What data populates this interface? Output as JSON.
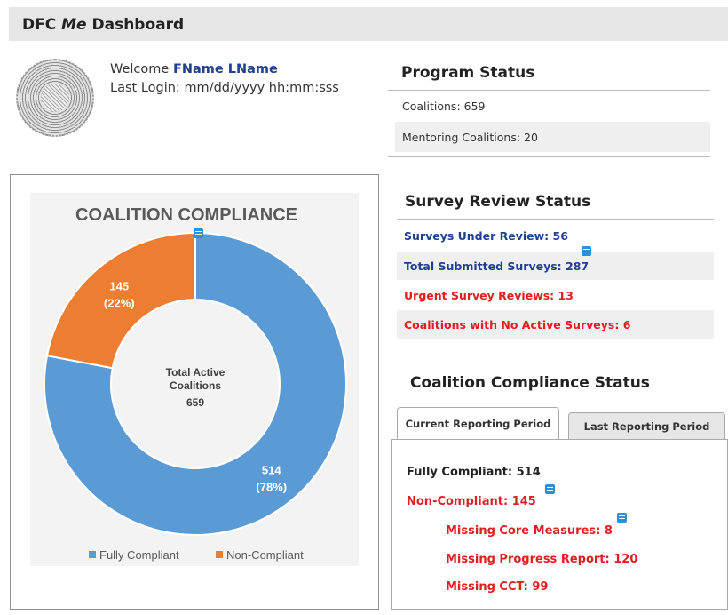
{
  "header": {
    "title_pre": "DFC ",
    "title_em": "Me",
    "title_post": " Dashboard"
  },
  "user": {
    "welcome_label": "Welcome",
    "name": "FName LName",
    "last_login_label": "Last Login:",
    "last_login_value": "mm/dd/yyyy  hh:mm:sss"
  },
  "program_status": {
    "heading": "Program Status",
    "rows": [
      "Coalitions: 659",
      "Mentoring Coalitions: 20"
    ]
  },
  "survey_review": {
    "heading": "Survey Review Status",
    "rows": [
      "Surveys Under Review: 56",
      "Total Submitted Surveys: 287",
      "Urgent Survey Reviews: 13",
      "Coalitions with No Active Surveys: 6"
    ]
  },
  "compliance_status": {
    "heading": "Coalition Compliance Status",
    "tabs": [
      "Current Reporting Period",
      "Last Reporting Period"
    ],
    "fully_compliant": "Fully Compliant: 514",
    "non_compliant": "Non-Compliant: 145",
    "sub_items": [
      "Missing Core Measures: 8",
      "Missing Progress Report: 120",
      "Missing CCT: 99"
    ]
  },
  "chart_data": {
    "type": "pie",
    "title": "COALITION COMPLIANCE",
    "center_text": [
      "Total Active",
      "Coalitions",
      "659"
    ],
    "categories": [
      "Fully Compliant",
      "Non-Compliant"
    ],
    "values": [
      514,
      145
    ],
    "percent_labels": [
      "(78%)",
      "(22%)"
    ],
    "colors": [
      "#5b9bd5",
      "#ed7d31"
    ],
    "legend_position": "bottom"
  }
}
